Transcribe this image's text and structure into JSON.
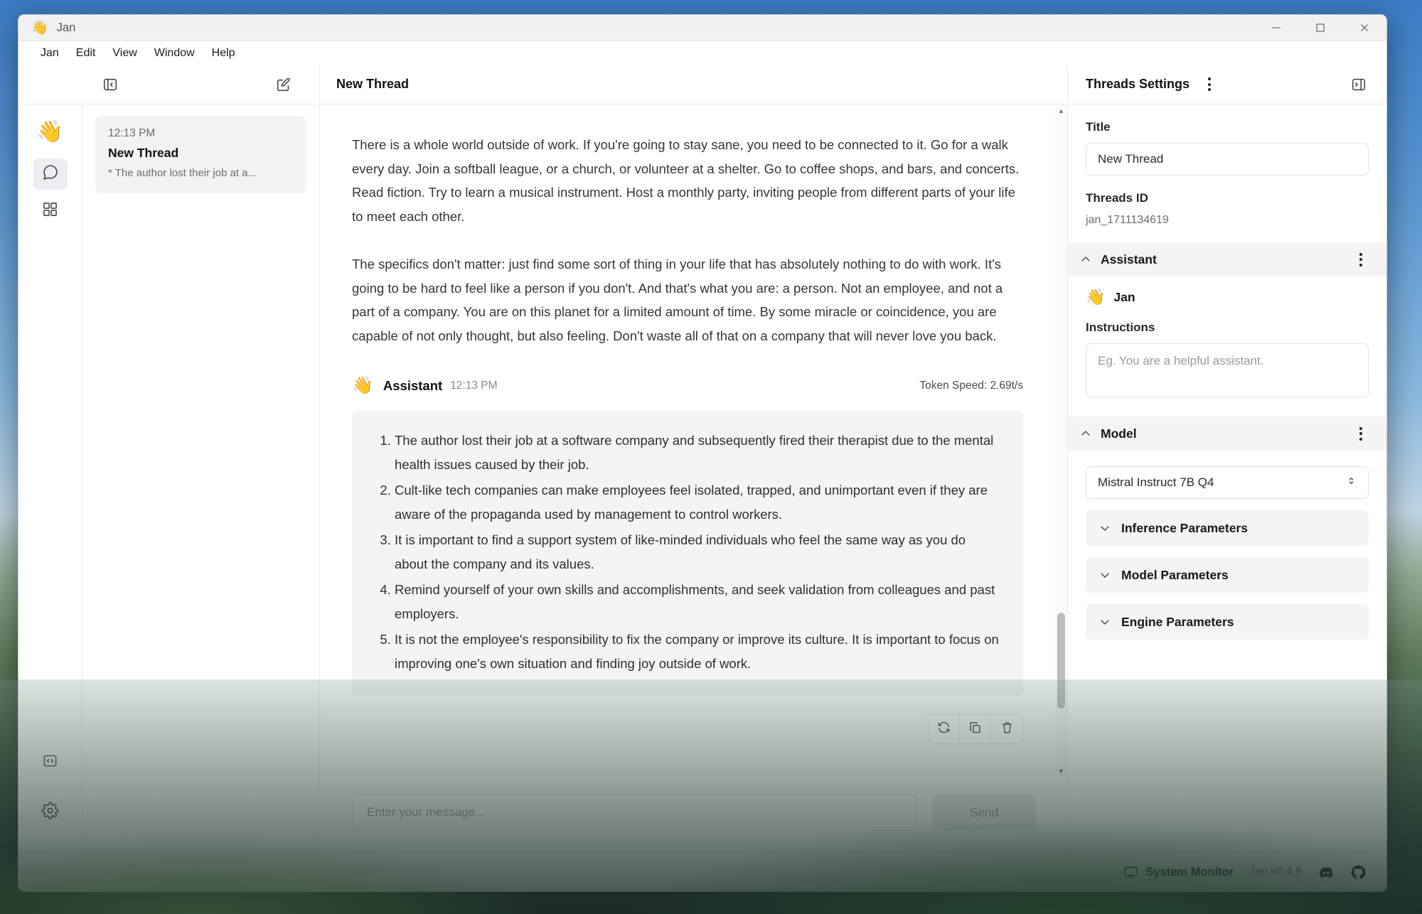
{
  "window": {
    "app_icon": "wave-emoji",
    "title": "Jan",
    "controls": {
      "minimize": "minimize",
      "maximize": "maximize",
      "close": "close"
    }
  },
  "menubar": {
    "items": [
      "Jan",
      "Edit",
      "View",
      "Window",
      "Help"
    ]
  },
  "left_panel": {
    "toolbar": {
      "collapse_icon": "panel-collapse-icon",
      "new_thread_icon": "compose-icon"
    },
    "rail": {
      "logo": "👋",
      "items": [
        {
          "name": "chat",
          "icon": "chat-bubble-icon",
          "active": true
        },
        {
          "name": "hub",
          "icon": "grid-icon",
          "active": false
        }
      ],
      "bottom_items": [
        {
          "name": "local-api-server",
          "icon": "code-brackets-icon"
        },
        {
          "name": "settings",
          "icon": "gear-icon"
        }
      ]
    },
    "threads": [
      {
        "time": "12:13 PM",
        "title": "New Thread",
        "snippet": "* The author lost their job at a..."
      }
    ]
  },
  "center_panel": {
    "header_title": "New Thread",
    "paragraphs": [
      "There is a whole world outside of work. If you're going to stay sane, you need to be connected to it. Go for a walk every day. Join a softball league, or a church, or volunteer at a shelter. Go to coffee shops, and bars, and concerts. Read fiction. Try to learn a musical instrument. Host a monthly party, inviting people from different parts of your life to meet each other.",
      "The specifics don't matter: just find some sort of thing in your life that has absolutely nothing to do with work. It's going to be hard to feel like a person if you don't. And that's what you are: a person. Not an employee, and not a part of a company. You are on this planet for a limited amount of time. By some miracle or coincidence, you are capable of not only thought, but also feeling. Don't waste all of that on a company that will never love you back."
    ],
    "assistant_message": {
      "avatar": "👋",
      "name": "Assistant",
      "time": "12:13 PM",
      "token_speed": "Token Speed: 2.69t/s",
      "list_items": [
        "The author lost their job at a software company and subsequently fired their therapist due to the mental health issues caused by their job.",
        "Cult-like tech companies can make employees feel isolated, trapped, and unimportant even if they are aware of the propaganda used by management to control workers.",
        "It is important to find a support system of like-minded individuals who feel the same way as you do about the company and its values.",
        "Remind yourself of your own skills and accomplishments, and seek validation from colleagues and past employers.",
        "It is not the employee's responsibility to fix the company or improve its culture. It is important to focus on improving one's own situation and finding joy outside of work."
      ],
      "actions": [
        {
          "name": "regenerate",
          "icon": "refresh-icon"
        },
        {
          "name": "copy",
          "icon": "copy-icon"
        },
        {
          "name": "delete",
          "icon": "trash-icon"
        }
      ]
    },
    "composer": {
      "placeholder": "Enter your message...",
      "value": "",
      "send_label": "Send"
    }
  },
  "right_panel": {
    "header": {
      "title": "Threads Settings",
      "kebab_icon": "more-vertical-icon",
      "collapse_icon": "panel-expand-icon"
    },
    "title_field": {
      "label": "Title",
      "value": "New Thread"
    },
    "threads_id": {
      "label": "Threads ID",
      "value": "jan_1711134619"
    },
    "assistant_section": {
      "label": "Assistant",
      "kebab_icon": "more-vertical-icon",
      "assistant_emoji": "👋",
      "assistant_name": "Jan",
      "instructions_label": "Instructions",
      "instructions_placeholder": "Eg. You are a helpful assistant.",
      "instructions_value": ""
    },
    "model_section": {
      "label": "Model",
      "kebab_icon": "more-vertical-icon",
      "selected_model": "Mistral Instruct 7B Q4",
      "accordions": [
        "Inference Parameters",
        "Model Parameters",
        "Engine Parameters"
      ]
    }
  },
  "statusbar": {
    "system_monitor": "System Monitor",
    "version": "Jan v0.4.9",
    "links": [
      {
        "name": "discord",
        "icon": "discord-icon"
      },
      {
        "name": "github",
        "icon": "github-icon"
      }
    ]
  },
  "colors": {
    "accent": "#1c1c20",
    "panel_bg": "#f4f4f5",
    "border": "#ebebeb",
    "muted_text": "#6d6d72"
  }
}
